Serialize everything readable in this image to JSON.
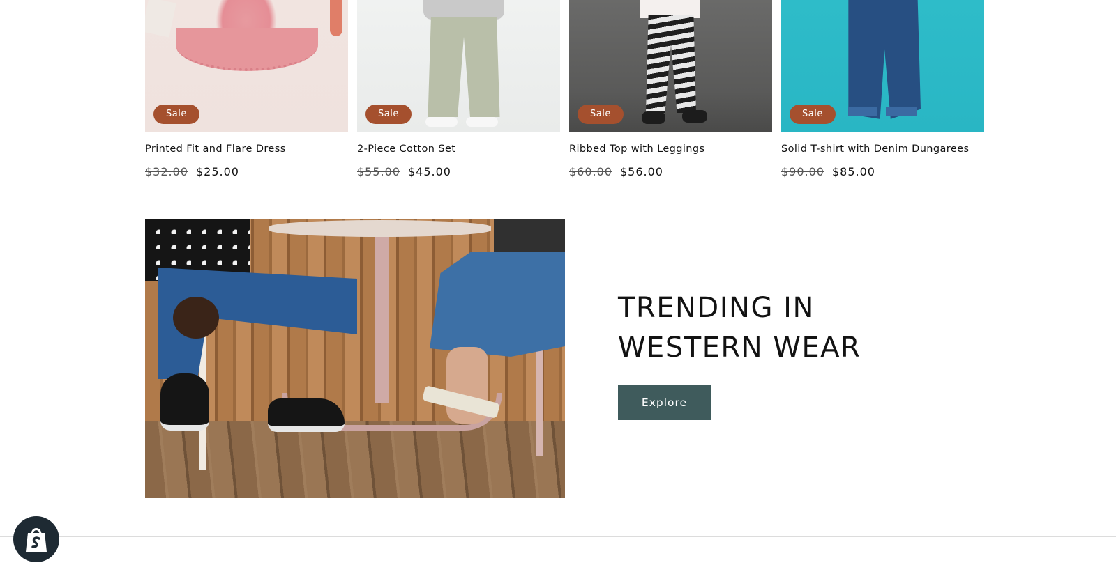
{
  "products": [
    {
      "title": "Printed Fit and Flare Dress",
      "badge": "Sale",
      "price_regular": "$32.00",
      "price_sale": "$25.00"
    },
    {
      "title": "2-Piece Cotton Set",
      "badge": "Sale",
      "price_regular": "$55.00",
      "price_sale": "$45.00"
    },
    {
      "title": "Ribbed Top with Leggings",
      "badge": "Sale",
      "price_regular": "$60.00",
      "price_sale": "$56.00"
    },
    {
      "title": "Solid T-shirt with Denim Dungarees",
      "badge": "Sale",
      "price_regular": "$90.00",
      "price_sale": "$85.00"
    }
  ],
  "feature": {
    "heading_line1": "TRENDING IN",
    "heading_line2": "WESTERN WEAR",
    "button_label": "Explore"
  },
  "colors": {
    "sale_badge": "#a5502e",
    "button": "#3f5b5c",
    "text": "#121212",
    "shopify_badge": "#1e2a33"
  },
  "icons": {
    "shopify": "shopping-bag-icon"
  }
}
